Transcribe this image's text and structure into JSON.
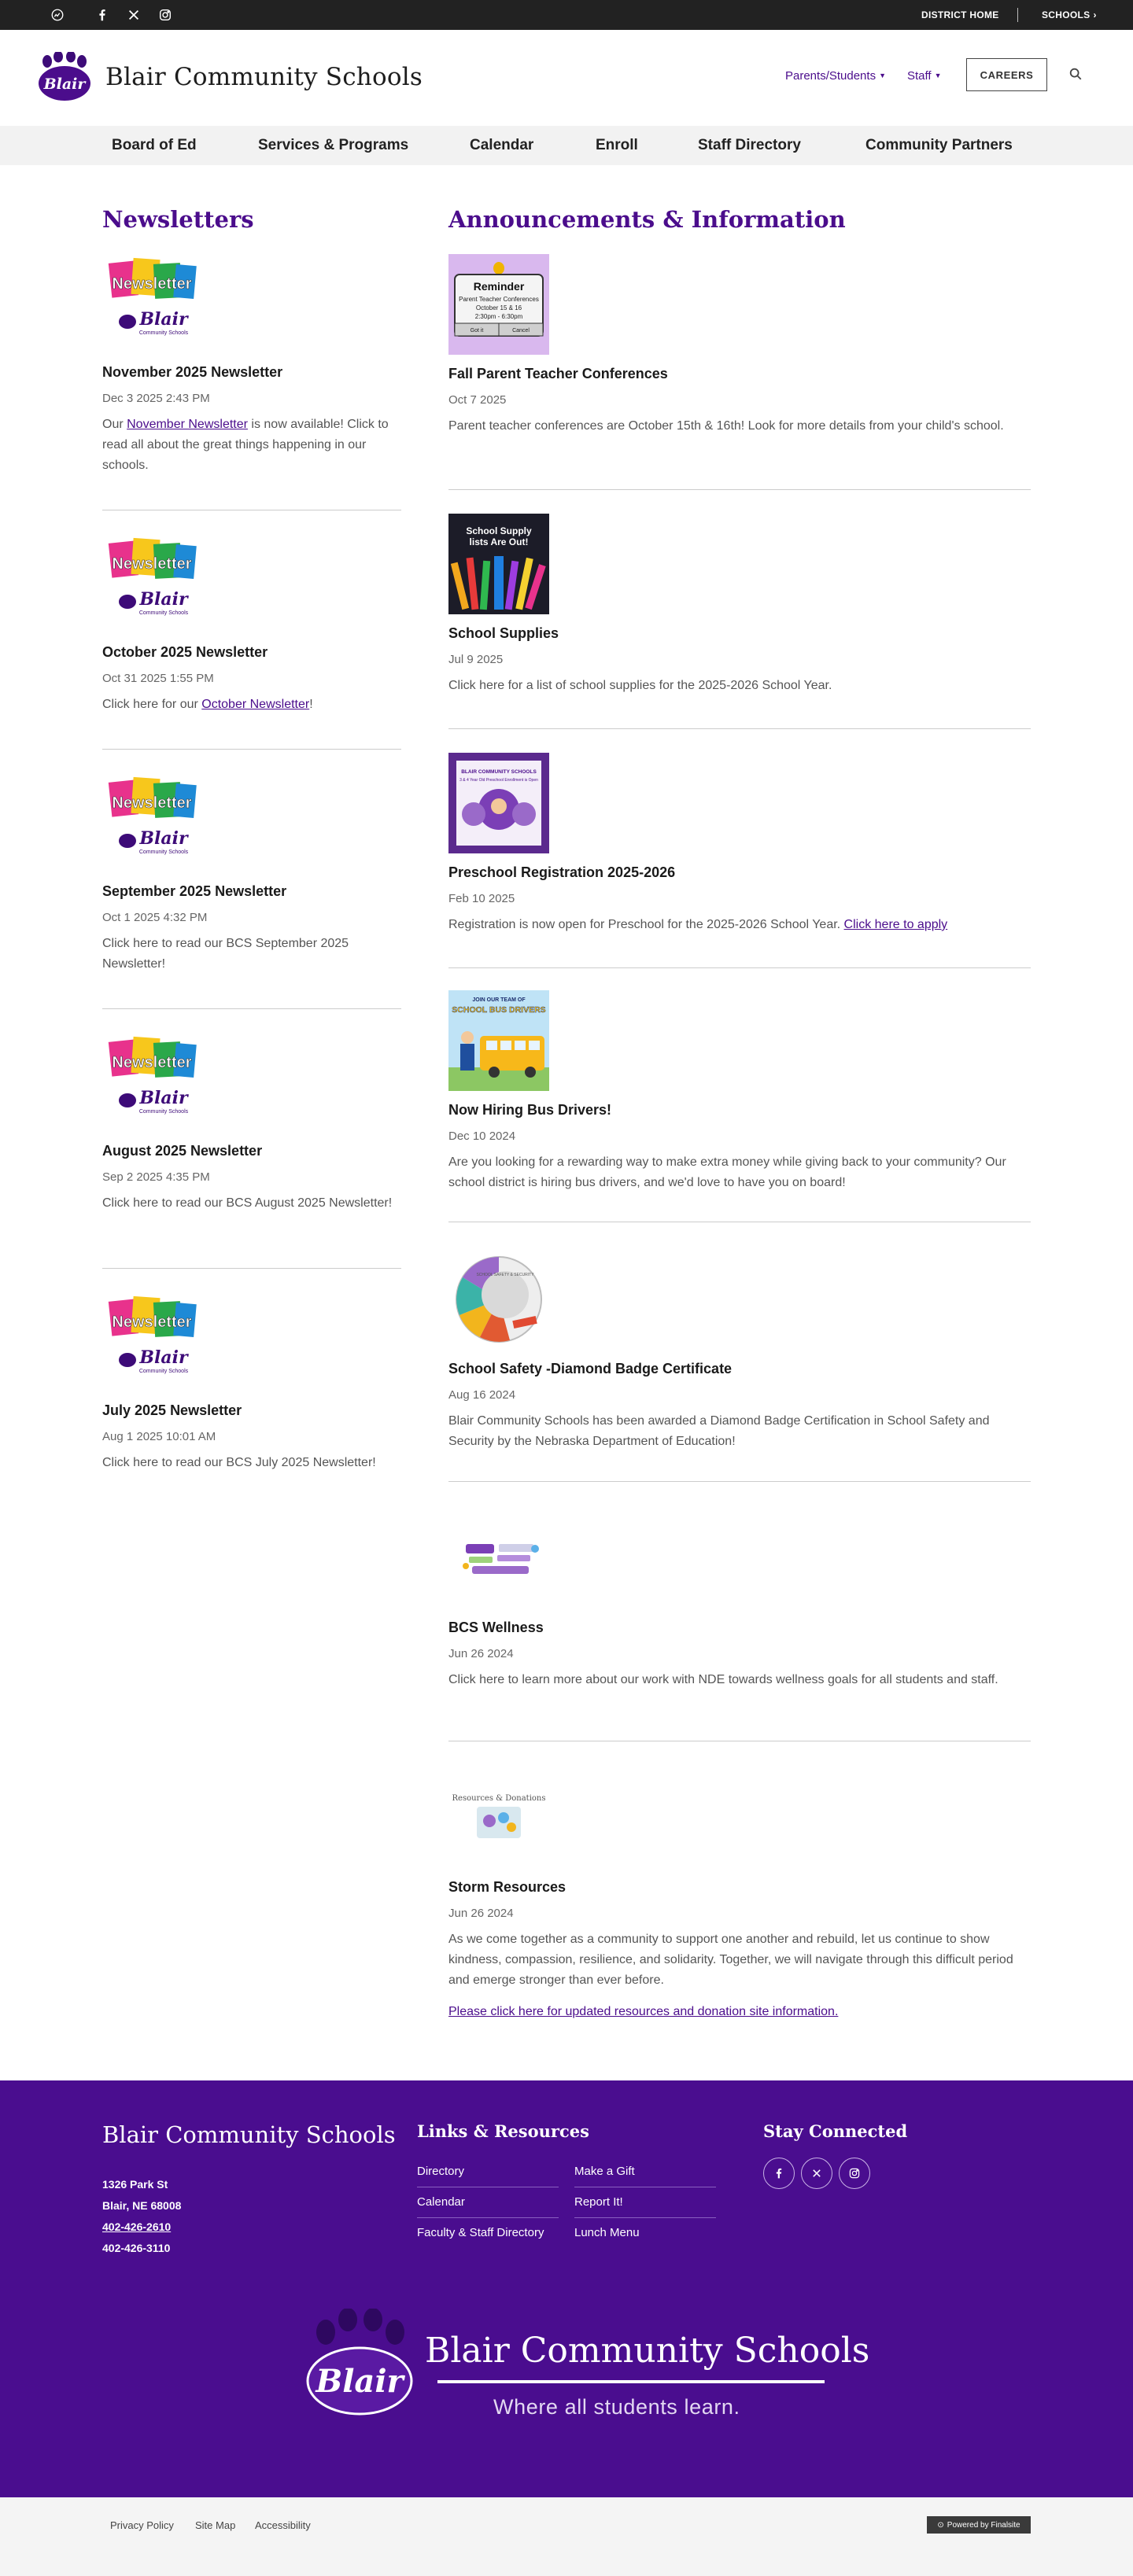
{
  "topbar": {
    "district_home": "DISTRICT HOME",
    "schools": "SCHOOLS",
    "social_icons": [
      "chat-icon",
      "facebook-icon",
      "x-icon",
      "instagram-icon"
    ]
  },
  "header": {
    "logo_text": "Blair",
    "title": "Blair Community Schools",
    "nav": [
      {
        "label": "Parents/Students"
      },
      {
        "label": "Staff"
      }
    ],
    "careers": "CAREERS"
  },
  "mainnav": [
    "Board of Ed",
    "Services & Programs",
    "Calendar",
    "Enroll",
    "Staff Directory",
    "Community Partners"
  ],
  "newsletters": {
    "title": "Newsletters",
    "image_text": {
      "line1": "Newsletter",
      "line2": "Blair",
      "line3": "Community Schools"
    },
    "items": [
      {
        "title": "November 2025 Newsletter",
        "date": "Dec 3 2025 2:43 PM",
        "desc_pre": "Our ",
        "desc_link": "November Newsletter",
        "desc_post": " is now available! Click to read all about the great things happening in our schools."
      },
      {
        "title": "October 2025 Newsletter",
        "date": "Oct 31 2025 1:55 PM",
        "desc_pre": "Click here for our ",
        "desc_link": "October Newsletter",
        "desc_post": "!"
      },
      {
        "title": "September 2025 Newsletter",
        "date": "Oct 1 2025 4:32 PM",
        "desc": "Click here to read our BCS September 2025 Newsletter!"
      },
      {
        "title": "August 2025 Newsletter",
        "date": "Sep 2 2025 4:35 PM",
        "desc": "Click here to read our BCS August 2025 Newsletter!"
      },
      {
        "title": "July 2025 Newsletter",
        "date": "Aug 1 2025 10:01 AM",
        "desc": "Click here to read our BCS July 2025 Newsletter!"
      }
    ]
  },
  "announcements": {
    "title": "Announcements & Information",
    "items": [
      {
        "title": "Fall Parent Teacher Conferences",
        "date": "Oct 7 2025",
        "desc": "Parent teacher conferences are October 15th & 16th! Look for more details from your child's school.",
        "img_lines": [
          "Reminder",
          "Parent Teacher Conferences",
          "October 15 & 16",
          "2:30pm - 6:30pm"
        ],
        "img_buttons": [
          "Got it",
          "Cancel"
        ]
      },
      {
        "title": "School Supplies",
        "date": "Jul 9 2025",
        "desc": "Click here for a list of school supplies for the 2025-2026 School Year.",
        "img_lines": [
          "School Supply",
          "lists Are Out!"
        ]
      },
      {
        "title": "Preschool Registration 2025-2026",
        "date": "Feb 10 2025",
        "desc_pre": "Registration is now open for Preschool for the 2025-2026 School Year. ",
        "desc_link": "Click here to apply",
        "img_lines": [
          "BLAIR COMMUNITY SCHOOLS",
          "3 & 4 Year Old Preschool Enrollment is Open"
        ]
      },
      {
        "title": "Now Hiring Bus Drivers!",
        "date": "Dec 10 2024",
        "desc": "Are you looking for a rewarding way to make extra money while giving back to your community? Our school district is hiring bus drivers, and we'd love to have you on board!",
        "img_lines": [
          "JOIN OUR TEAM OF",
          "SCHOOL BUS DRIVERS"
        ]
      },
      {
        "title": "School Safety -Diamond Badge Certificate",
        "date": "Aug 16 2024",
        "desc": "Blair Community Schools has been awarded a Diamond Badge Certification in School Safety and Security by the Nebraska Department of Education!",
        "img_lines": [
          "SCHOOL SAFETY & SECURITY"
        ]
      },
      {
        "title": "BCS Wellness",
        "date": "Jun 26 2024",
        "desc": "Click here to learn more about our work with NDE towards wellness goals for all students and staff."
      },
      {
        "title": "Storm Resources",
        "date": "Jun 26 2024",
        "desc": "As we come together as a community to support one another and rebuild, let us continue to show kindness, compassion, resilience, and solidarity. Together, we will navigate through this difficult period and emerge stronger than ever before.",
        "link": "Please click here for updated resources and donation site information.",
        "img_lines": [
          "Resources & Donations"
        ]
      }
    ]
  },
  "footer": {
    "title": "Blair Community Schools",
    "address": [
      "1326 Park St",
      "Blair, NE  68008"
    ],
    "phone1": "402-426-2610",
    "phone2": "402-426-3110",
    "links_title": "Links & Resources",
    "links": [
      "Directory",
      "Calendar",
      "Faculty & Staff Directory",
      "Make a Gift",
      "Report It!",
      "Lunch Menu"
    ],
    "stay_title": "Stay Connected",
    "social_icons": [
      "facebook-icon",
      "x-icon",
      "instagram-icon"
    ],
    "logo_text": "Blair",
    "logo_name": "Blair Community Schools",
    "tagline": "Where all students learn."
  },
  "bottombar": {
    "links": [
      "Privacy Policy",
      "Site Map",
      "Accessibility"
    ],
    "powered": "Powered by Finalsite"
  },
  "colors": {
    "brand_purple": "#4a0d8f",
    "heading_purple": "#4b0d8c",
    "topbar": "#222222",
    "nav_bg": "#f2f2f2"
  }
}
